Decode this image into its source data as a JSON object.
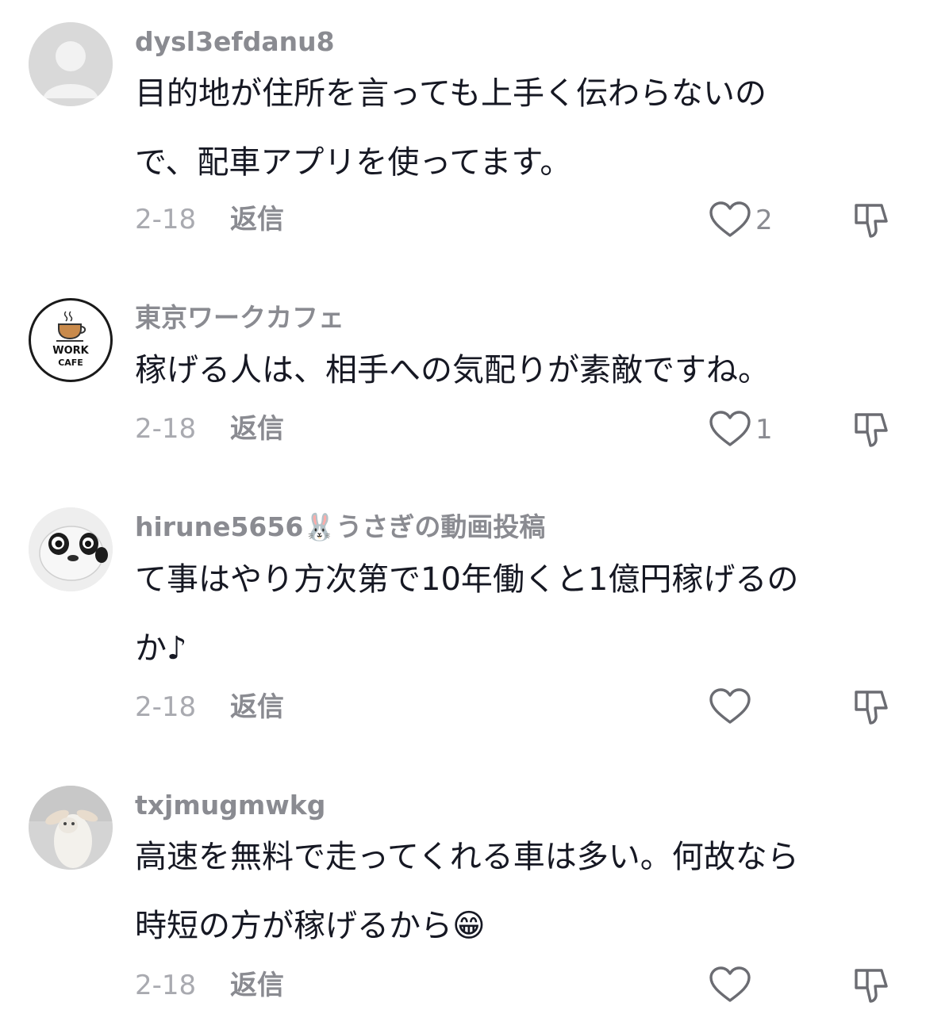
{
  "comments": [
    {
      "username": "dysl3efdanu8",
      "avatar_icon": "default-avatar-icon",
      "body_lines": [
        "目的地が住所を言っても上手く伝わらないの",
        "で、配車アプリを使ってます。"
      ],
      "date": "2-18",
      "reply_label": "返信",
      "like_count": "2"
    },
    {
      "username": "東京ワークカフェ",
      "avatar_icon": "work-cafe-logo-icon",
      "avatar_logo_text": [
        "WORK",
        "CAFE"
      ],
      "body_lines": [
        "稼げる人は、相手への気配りが素敵ですね。"
      ],
      "date": "2-18",
      "reply_label": "返信",
      "like_count": "1"
    },
    {
      "username": "hirune5656🐰うさぎの動画投稿",
      "avatar_icon": "panda-rabbit-avatar-icon",
      "body_lines": [
        "て事はやり方次第で10年働くと1億円稼げるの",
        "か♪"
      ],
      "date": "2-18",
      "reply_label": "返信",
      "like_count": ""
    },
    {
      "username": "txjmugmwkg",
      "avatar_icon": "goat-photo-avatar-icon",
      "body_lines": [
        "高速を無料で走ってくれる車は多い。何故なら",
        "時短の方が稼げるから😁"
      ],
      "date": "2-18",
      "reply_label": "返信",
      "like_count": ""
    }
  ],
  "colors": {
    "text_primary": "#161823",
    "text_secondary": "#8a8b91",
    "date": "#a9aab0",
    "icon_stroke": "#6b6c72"
  }
}
